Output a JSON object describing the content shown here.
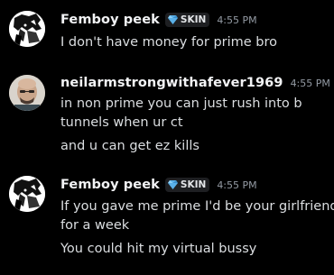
{
  "messages": [
    {
      "author": "Femboy peek",
      "tag": "SKIN",
      "timestamp": "4:55 PM",
      "lines": [
        "I don't have money for prime bro"
      ]
    },
    {
      "author": "neilarmstrongwithafever1969",
      "timestamp": "4:55 PM",
      "lines": [
        "in non prime you can just rush into b",
        "tunnels when ur ct",
        "and u can get ez kills"
      ]
    },
    {
      "author": "Femboy peek",
      "tag": "SKIN",
      "timestamp": "4:55 PM",
      "lines": [
        "If you gave me prime I'd be your girlfriend",
        "for a week",
        "You could hit my virtual bussy"
      ]
    }
  ],
  "colors": {
    "background": "#000000",
    "username": "#f2f3f5",
    "message_text": "#dbdee1",
    "timestamp": "#949ba4",
    "tag_background": "#1e1f22",
    "gem": "#5ab0e8"
  },
  "icons": {
    "avatar_1": "anime-character-avatar",
    "tag_icon": "diamond-gem-icon",
    "avatar_2": "bald-man-avatar"
  }
}
